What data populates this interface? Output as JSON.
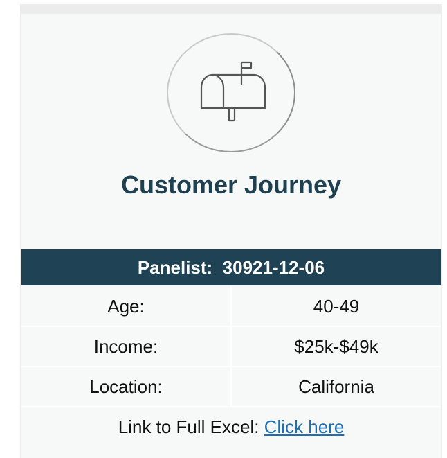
{
  "card": {
    "icon": "mailbox-icon",
    "title": "Customer Journey"
  },
  "panelist": {
    "label": "Panelist:",
    "id": "30921-12-06"
  },
  "rows": [
    {
      "label": "Age:",
      "value": "40-49"
    },
    {
      "label": "Income:",
      "value": "$25k-$49k"
    },
    {
      "label": "Location:",
      "value": "California"
    }
  ],
  "footer": {
    "prefix": "Link to Full Excel:",
    "link_text": "Click here"
  },
  "colors": {
    "header_bg": "#1f4254",
    "title": "#1f4050",
    "link": "#1f6fb8"
  }
}
